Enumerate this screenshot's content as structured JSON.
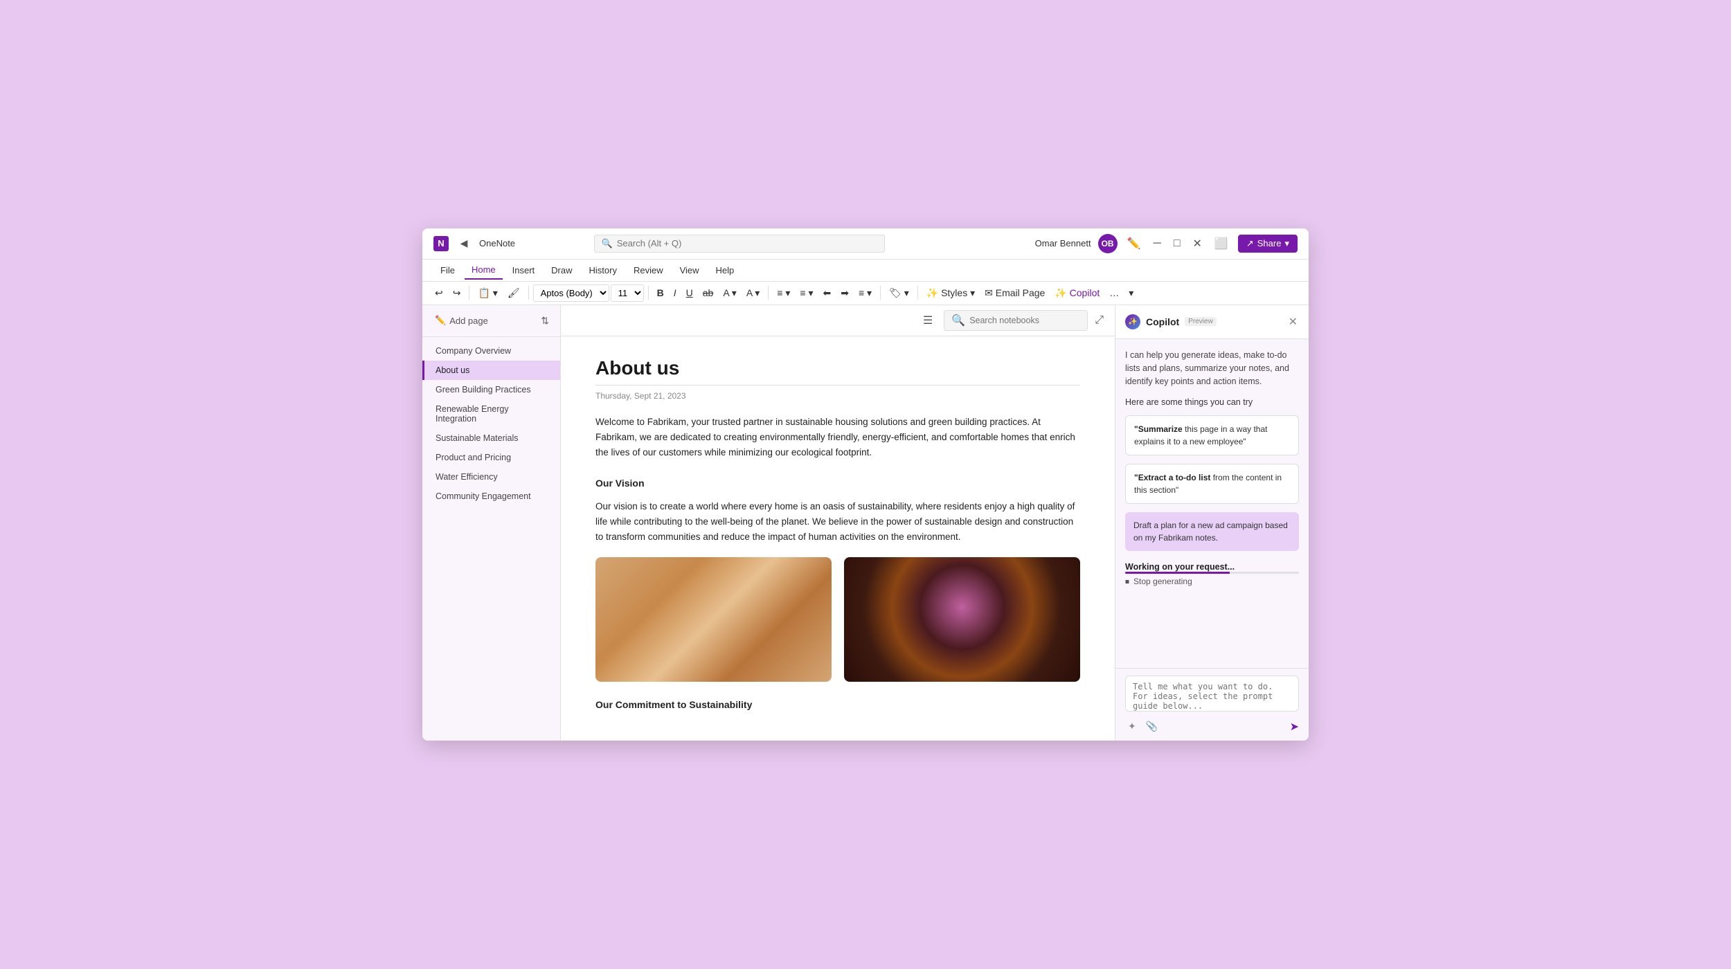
{
  "window": {
    "logo": "N",
    "app_title": "OneNote",
    "search_placeholder": "Search (Alt + Q)",
    "user_name": "Omar Bennett",
    "user_initials": "OB",
    "share_label": "Share",
    "minimize": "─",
    "maximize": "□",
    "close": "✕"
  },
  "menu": {
    "items": [
      "File",
      "Home",
      "Insert",
      "Draw",
      "History",
      "Review",
      "View",
      "Help"
    ],
    "active": "Home"
  },
  "toolbar": {
    "undo": "↩",
    "redo": "↪",
    "font_name": "Aptos (Body)",
    "font_size": "11",
    "bold": "B",
    "italic": "I",
    "underline": "U",
    "strikethrough": "ab",
    "highlight": "A",
    "font_color": "A",
    "bullets": "≡",
    "numbering": "≡",
    "outdent": "←",
    "indent": "→",
    "align": "≡",
    "more_btn": "...",
    "styles_label": "Styles",
    "email_page_label": "Email Page",
    "copilot_label": "Copilot"
  },
  "sidebar": {
    "add_page_label": "Add page",
    "sort_icon": "⇅",
    "pages": [
      {
        "id": "company-overview",
        "label": "Company Overview",
        "active": false
      },
      {
        "id": "about-us",
        "label": "About us",
        "active": true
      },
      {
        "id": "green-building",
        "label": "Green Building Practices",
        "active": false
      },
      {
        "id": "renewable-energy",
        "label": "Renewable Energy Integration",
        "active": false
      },
      {
        "id": "sustainable-materials",
        "label": "Sustainable Materials",
        "active": false
      },
      {
        "id": "product-pricing",
        "label": "Product and Pricing",
        "active": false
      },
      {
        "id": "water-efficiency",
        "label": "Water Efficiency",
        "active": false
      },
      {
        "id": "community-engagement",
        "label": "Community Engagement",
        "active": false
      }
    ]
  },
  "content": {
    "search_notebooks_placeholder": "Search notebooks",
    "page_title": "About us",
    "page_date": "Thursday, Sept 21, 2023",
    "intro_text": "Welcome to Fabrikam, your trusted partner in sustainable housing solutions and green building practices. At Fabrikam, we are dedicated to creating environmentally friendly, energy-efficient, and comfortable homes that enrich the lives of our customers while minimizing our ecological footprint.",
    "vision_heading": "Our Vision",
    "vision_text": "Our vision is to create a world where every home is an oasis of sustainability, where residents enjoy a high quality of life while contributing to the well-being of the planet. We believe in the power of sustainable design and construction to transform communities and reduce the impact of human activities on the environment.",
    "commitment_heading": "Our Commitment to Sustainability"
  },
  "copilot": {
    "title": "Copilot",
    "badge": "Preview",
    "intro": "I can help you generate ideas, make to-do lists and plans, summarize your notes, and identify key points and action items.",
    "try_label": "Here are some things you can try",
    "suggestion1_prefix": "\"Summarize",
    "suggestion1_rest": " this page in a way that explains it to a new employee\"",
    "suggestion2_prefix": "\"Extract a to-do list",
    "suggestion2_rest": " from the content in this section\"",
    "user_message": "Draft a plan for a new ad campaign based on my Fabrikam notes.",
    "working_label": "Working on your request...",
    "stop_label": "Stop generating",
    "input_placeholder": "Tell me what you want to do. For ideas, select the prompt guide below...",
    "send_icon": "➤"
  }
}
